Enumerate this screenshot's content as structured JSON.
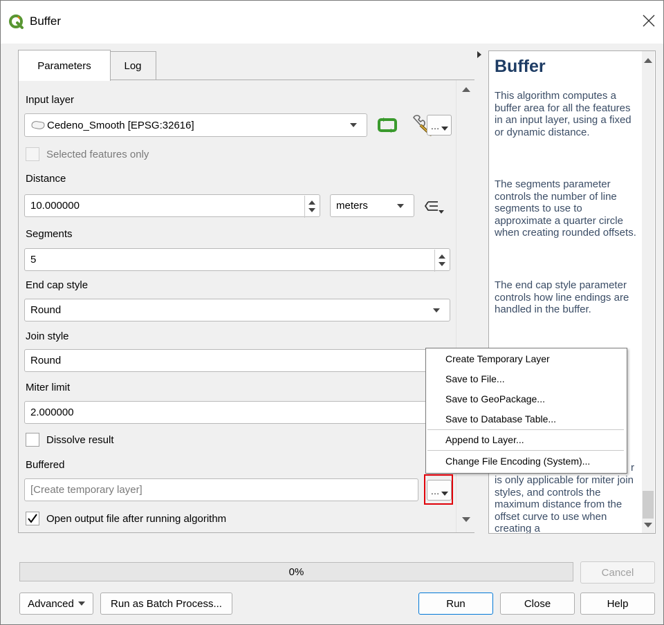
{
  "window": {
    "title": "Buffer"
  },
  "tabs": [
    "Parameters",
    "Log"
  ],
  "params": {
    "input_layer_label": "Input layer",
    "input_layer_value": "Cedeno_Smooth [EPSG:32616]",
    "input_layer_more": "…",
    "selected_only_label": "Selected features only",
    "distance_label": "Distance",
    "distance_value": "10.000000",
    "distance_unit": "meters",
    "segments_label": "Segments",
    "segments_value": "5",
    "end_cap_label": "End cap style",
    "end_cap_value": "Round",
    "join_label": "Join style",
    "join_value": "Round",
    "miter_label": "Miter limit",
    "miter_value": "2.000000",
    "dissolve_label": "Dissolve result",
    "output_label": "Buffered",
    "output_placeholder": "[Create temporary layer]",
    "output_more": "…",
    "open_output_label": "Open output file after running algorithm"
  },
  "help": {
    "title": "Buffer",
    "p1": "This algorithm computes a buffer area for all the features in an input layer, using a fixed or dynamic distance.",
    "p2": "The segments parameter controls the number of line segments to use to approximate a quarter circle when creating rounded offsets.",
    "p3": "The end cap style parameter controls how line endings are handled in the buffer.",
    "p4a": "r",
    "p4b": "is only applicable for miter join styles, and controls the maximum distance from the offset curve to use when creating a"
  },
  "menu": [
    "Create Temporary Layer",
    "Save to File...",
    "Save to GeoPackage...",
    "Save to Database Table...",
    "Append to Layer...",
    "Change File Encoding (System)..."
  ],
  "progress": {
    "percent_label": "0%",
    "value": 0
  },
  "buttons": {
    "cancel": "Cancel",
    "advanced": "Advanced",
    "batch": "Run as Batch Process...",
    "run": "Run",
    "close": "Close",
    "help": "Help"
  },
  "colors": {
    "accent": "#0078d7",
    "highlight_box": "#e0000a",
    "qgis_green": "#589632",
    "help_text": "#3b4d66"
  }
}
